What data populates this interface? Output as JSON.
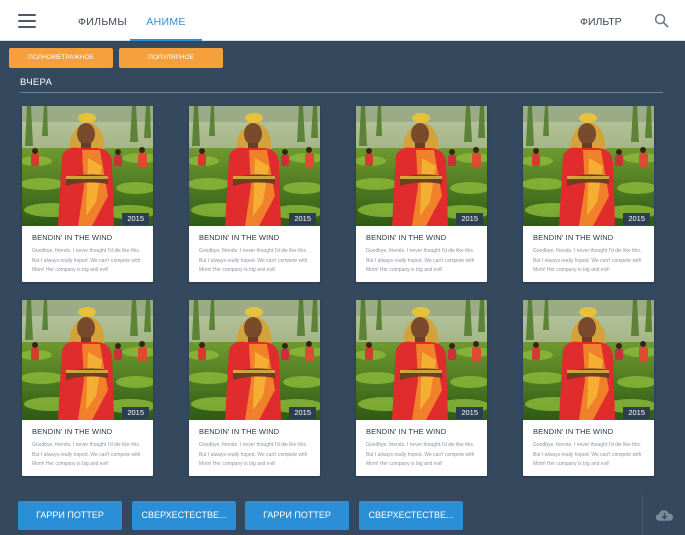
{
  "header": {
    "tabs": [
      {
        "label": "ФИЛЬМЫ"
      },
      {
        "label": "АНИМЕ",
        "active": true
      }
    ],
    "filter_label": "ФИЛЬТР"
  },
  "chips": [
    {
      "label": "ПОЛНОМЕТРАЖНОЕ"
    },
    {
      "label": "ПОПУЛЯРНОЕ"
    }
  ],
  "section": {
    "title": "ВЧЕРА"
  },
  "cards": [
    {
      "title": "BENDIN' IN THE WIND",
      "year": "2015",
      "desc": "Goodbye, friends. I never thought I'd die like this. But I always really hoped. We can't compete with Mom! Her company is big and evil!"
    },
    {
      "title": "BENDIN' IN THE WIND",
      "year": "2015",
      "desc": "Goodbye, friends. I never thought I'd die like this. But I always really hoped. We can't compete with Mom! Her company is big and evil!"
    },
    {
      "title": "BENDIN' IN THE WIND",
      "year": "2015",
      "desc": "Goodbye, friends. I never thought I'd die like this. But I always really hoped. We can't compete with Mom! Her company is big and evil!"
    },
    {
      "title": "BENDIN' IN THE WIND",
      "year": "2015",
      "desc": "Goodbye, friends. I never thought I'd die like this. But I always really hoped. We can't compete with Mom! Her company is big and evil!"
    },
    {
      "title": "BENDIN' IN THE WIND",
      "year": "2015",
      "desc": "Goodbye, friends. I never thought I'd die like this. But I always really hoped. We can't compete with Mom! Her company is big and evil!"
    },
    {
      "title": "BENDIN' IN THE WIND",
      "year": "2015",
      "desc": "Goodbye, friends. I never thought I'd die like this. But I always really hoped. We can't compete with Mom! Her company is big and evil!"
    },
    {
      "title": "BENDIN' IN THE WIND",
      "year": "2015",
      "desc": "Goodbye, friends. I never thought I'd die like this. But I always really hoped. We can't compete with Mom! Her company is big and evil!"
    },
    {
      "title": "BENDIN' IN THE WIND",
      "year": "2015",
      "desc": "Goodbye, friends. I never thought I'd die like this. But I always really hoped. We can't compete with Mom! Her company is big and evil!"
    }
  ],
  "bottom_buttons": [
    {
      "label": "ГАРРИ ПОТТЕР"
    },
    {
      "label": "СВЕРХЕСТЕСТВЕ..."
    },
    {
      "label": "ГАРРИ ПОТТЕР"
    },
    {
      "label": "СВЕРХЕСТЕСТВЕ..."
    }
  ],
  "icons": {
    "menu": "hamburger-menu-icon",
    "search": "search-icon",
    "cloud": "cloud-download-icon"
  },
  "colors": {
    "background": "#34495e",
    "accent_blue": "#2a8fd7",
    "chip_orange": "#f5a03c",
    "year_badge": "#2c3e50"
  }
}
